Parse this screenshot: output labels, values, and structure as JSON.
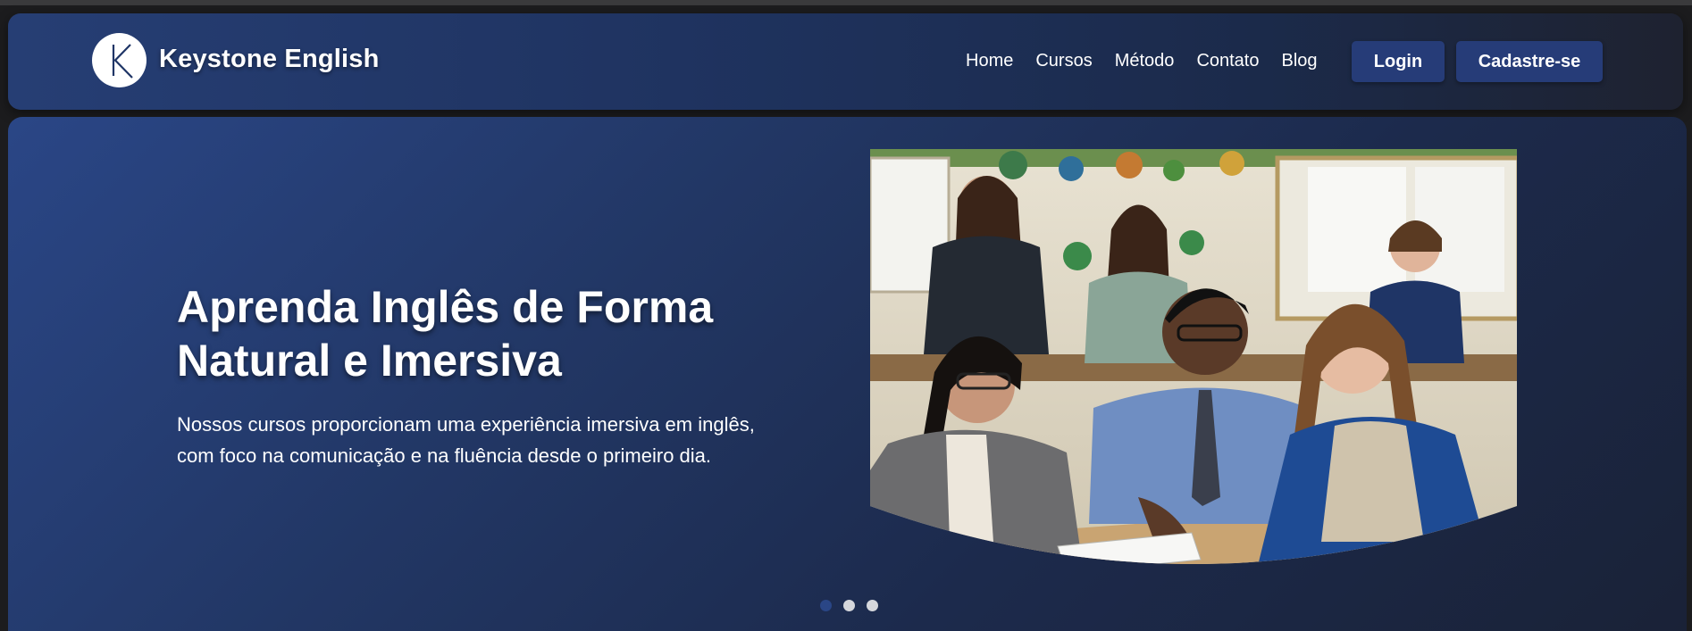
{
  "brand": {
    "name": "Keystone English",
    "logo_letter": "K",
    "logo_icon": "k-monogram-icon"
  },
  "nav": {
    "links": [
      "Home",
      "Cursos",
      "Método",
      "Contato",
      "Blog"
    ],
    "login_label": "Login",
    "signup_label": "Cadastre-se"
  },
  "hero": {
    "title_line1": "Aprenda Inglês de Forma",
    "title_line2": "Natural e Imersiva",
    "desc_line1": "Nossos cursos proporcionam uma experiência imersiva em inglês,",
    "desc_line2": "com foco na comunicação e na fluência desde o primeiro dia.",
    "image_subject": "students-studying-in-classroom"
  },
  "carousel": {
    "slide_count": 3,
    "active_index": 0
  },
  "colors": {
    "navbar": "#233a6c",
    "hero": "#223765",
    "button": "#263c78",
    "active_dot": "#2a4686",
    "inactive_dot": "#d5d7dc"
  }
}
